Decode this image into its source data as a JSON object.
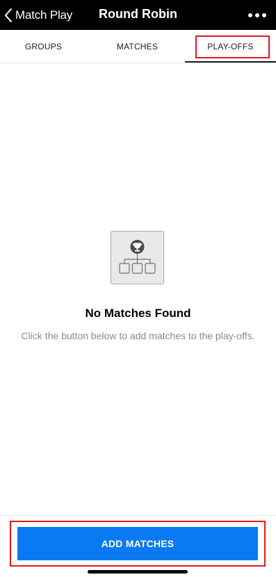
{
  "navbar": {
    "back_label": "Match Play",
    "title": "Round Robin",
    "back_icon": "chevron-left-icon",
    "more_icon": "ellipsis-icon"
  },
  "tabs": [
    {
      "label": "GROUPS",
      "selected": false
    },
    {
      "label": "MATCHES",
      "selected": false
    },
    {
      "label": "PLAY-OFFS",
      "selected": true
    }
  ],
  "empty_state": {
    "icon": "bracket-trophy-icon",
    "title": "No Matches Found",
    "description": "Click the button below to add  matches  to the play-offs."
  },
  "footer": {
    "add_button_label": "ADD MATCHES"
  },
  "colors": {
    "navbar_bg": "#000000",
    "accent_button": "#0a79f2",
    "highlight_border": "#e3161b",
    "muted_text": "#8a8a8a"
  }
}
